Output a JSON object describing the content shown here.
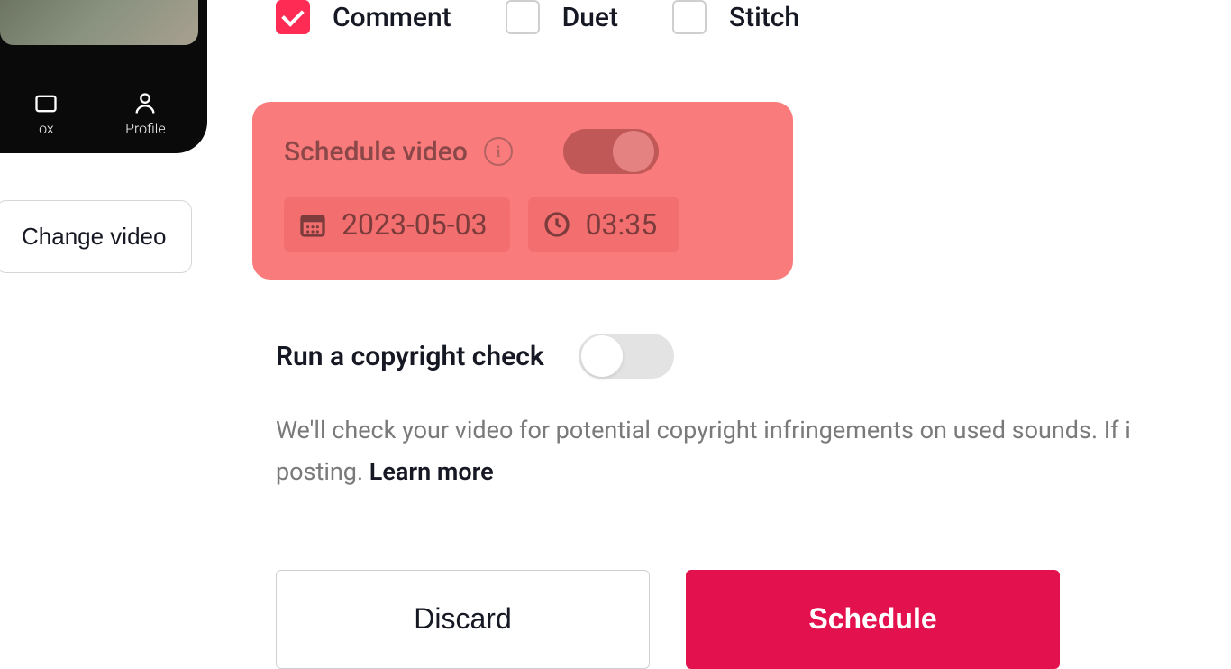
{
  "phone": {
    "nav": {
      "inbox": "ox",
      "profile": "Profile"
    }
  },
  "changeVideo": "Change video",
  "allow": {
    "comment": "Comment",
    "duet": "Duet",
    "stitch": "Stitch"
  },
  "schedule": {
    "title": "Schedule video",
    "date": "2023-05-03",
    "time": "03:35"
  },
  "copyright": {
    "title": "Run a copyright check",
    "descPart1": "We'll check your video for potential copyright infringements on used sounds. If i",
    "descPart2": "posting.",
    "learnMore": "Learn more"
  },
  "buttons": {
    "discard": "Discard",
    "schedule": "Schedule"
  }
}
